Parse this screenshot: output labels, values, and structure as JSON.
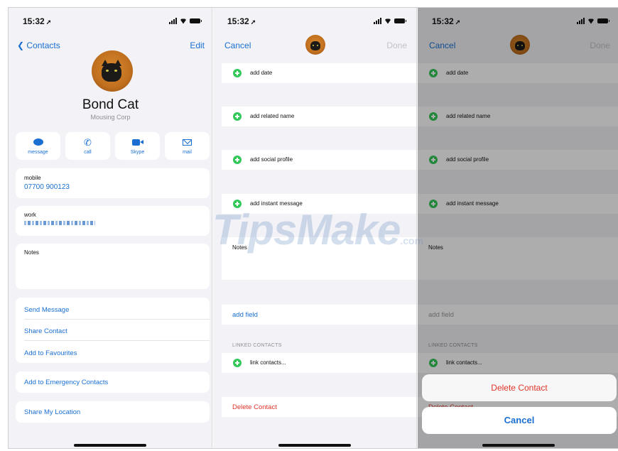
{
  "status": {
    "time": "15:32"
  },
  "colors": {
    "accent": "#1a6fd1",
    "destructive": "#e0352b",
    "add": "#34c759"
  },
  "screen1": {
    "back_label": "Contacts",
    "edit_label": "Edit",
    "name": "Bond Cat",
    "company": "Mousing Corp",
    "actions": [
      {
        "label": "message",
        "icon": "message-bubble-icon"
      },
      {
        "label": "call",
        "icon": "phone-icon"
      },
      {
        "label": "Skype",
        "icon": "video-camera-icon"
      },
      {
        "label": "mail",
        "icon": "envelope-icon"
      }
    ],
    "mobile_label": "mobile",
    "mobile_value": "07700 900123",
    "work_label": "work",
    "notes_label": "Notes",
    "links": [
      "Send Message",
      "Share Contact",
      "Add to Favourites"
    ],
    "emergency": "Add to Emergency Contacts",
    "share_location": "Share My Location"
  },
  "screen2": {
    "cancel_label": "Cancel",
    "done_label": "Done",
    "rows": [
      "add date",
      "add related name",
      "add social profile",
      "add instant message"
    ],
    "notes_label": "Notes",
    "add_field": "add field",
    "linked_header": "LINKED CONTACTS",
    "link_contacts": "link contacts...",
    "delete_contact": "Delete Contact"
  },
  "screen3": {
    "sheet_delete": "Delete Contact",
    "sheet_cancel": "Cancel"
  },
  "watermark": {
    "main": "TipsMake",
    "suffix": ".com"
  }
}
